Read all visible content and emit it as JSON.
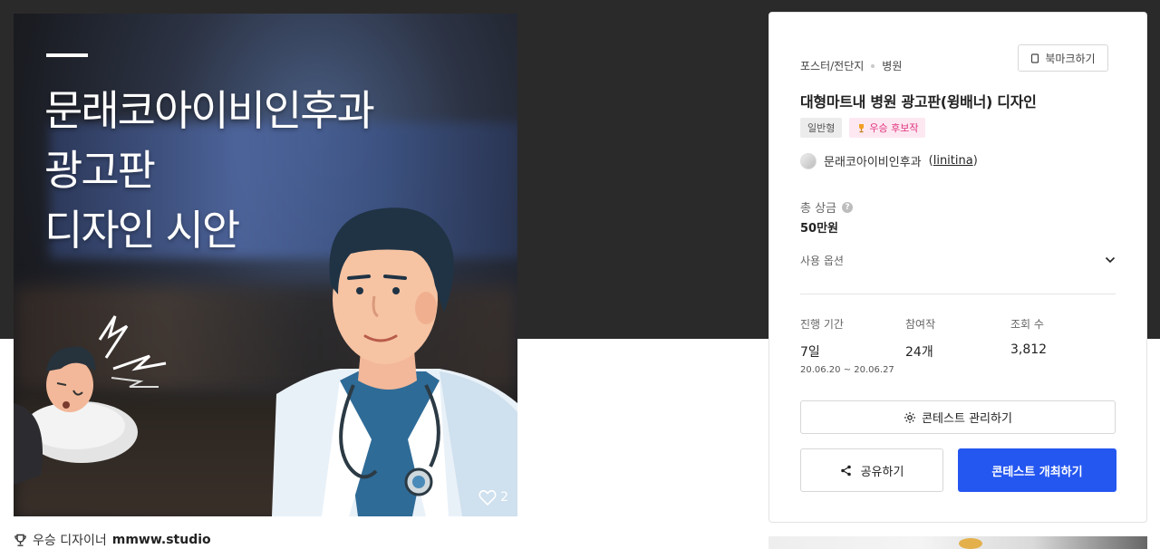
{
  "hero": {
    "title": "문래코아이비인후과\n광고판\n디자인 시안",
    "likes": "2"
  },
  "award": {
    "prefix": "우승 디자이너",
    "name": "mmww.studio"
  },
  "card": {
    "category": "포스터/전단지",
    "subcategory": "병원",
    "bookmark_label": "북마크하기",
    "title": "대형마트내 병원 광고판(윙배너) 디자인",
    "tags": [
      "일반형",
      "우승 후보작"
    ],
    "owner_name": "문래코아이비인후과",
    "owner_handle": "linitina",
    "prize_label": "총 상금",
    "prize_value": "50만원",
    "options_label": "사용 옵션",
    "stats": [
      {
        "label": "진행 기간",
        "value": "7일",
        "sub": "20.06.20 ~ 20.06.27"
      },
      {
        "label": "참여작",
        "value": "24개"
      },
      {
        "label": "조회 수",
        "value": "3,812"
      }
    ],
    "manage_label": "콘테스트 관리하기",
    "share_label": "공유하기",
    "host_label": "콘테스트 개최하기",
    "accent_color": "#2456f0"
  }
}
